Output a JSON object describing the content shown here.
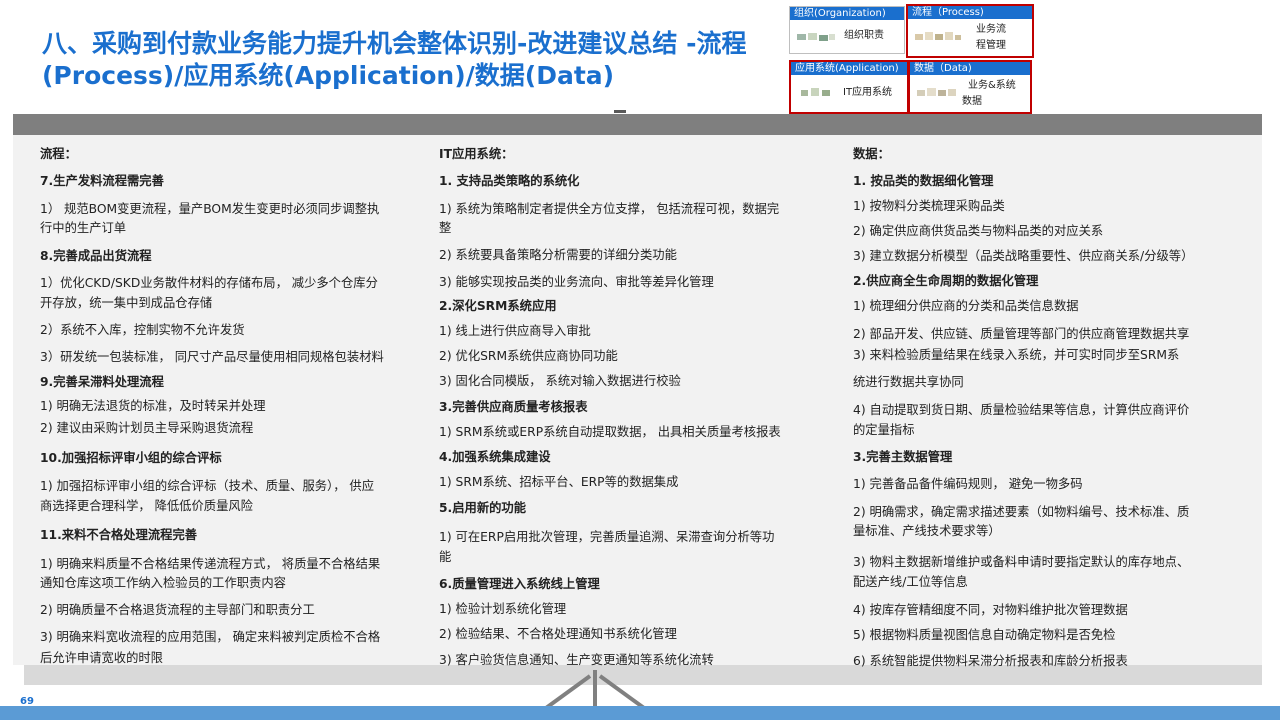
{
  "title": {
    "line1": "八、采购到付款业务能力提升机会整体识别-改进建议总结 -流程",
    "line2": "(Process)/应用系统(Application)/数据(Data)"
  },
  "legend": {
    "org": {
      "header": "组织(Organization)",
      "label": "组织职责"
    },
    "process": {
      "header": "流程（Process)",
      "label1": "业务流",
      "label2": "程管理"
    },
    "app": {
      "header": "应用系统(Application)",
      "label": "IT应用系统"
    },
    "data": {
      "header": "数据（Data)",
      "label1": "业务&系统",
      "label2": "数据"
    }
  },
  "columns": {
    "process": {
      "heading": "流程：",
      "lines": [
        {
          "text": "7.生产发料流程需完善",
          "type": "sec"
        },
        {
          "text": "1）  规范BOM变更流程，量产BOM发生变更时必须同步调整执",
          "type": "item"
        },
        {
          "text": "      行中的生产订单",
          "type": "item"
        },
        {
          "text": "8.完善成品出货流程",
          "type": "sec"
        },
        {
          "text": "1）优化CKD/SKD业务散件材料的存储布局，  减少多个仓库分",
          "type": "item"
        },
        {
          "text": "开存放，统一集中到成品仓存储",
          "type": "item"
        },
        {
          "text": "2）系统不入库，控制实物不允许发货",
          "type": "item"
        },
        {
          "text": "3）研发统一包装标准，  同尺寸产品尽量使用相同规格包装材料",
          "type": "item"
        },
        {
          "text": "9.完善呆滞料处理流程",
          "type": "sec"
        },
        {
          "text": "1)    明确无法退货的标准，及时转呆并处理",
          "type": "item"
        },
        {
          "text": "2)    建议由采购计划员主导采购退货流程",
          "type": "item"
        },
        {
          "text": "10.加强招标评审小组的综合评标",
          "type": "sec"
        },
        {
          "text": "1)    加强招标评审小组的综合评标（技术、质量、服务），  供应",
          "type": "item"
        },
        {
          "text": "      商选择更合理科学，  降低低价质量风险",
          "type": "item"
        },
        {
          "text": "11.来料不合格处理流程完善",
          "type": "sec"
        },
        {
          "text": "1)    明确来料质量不合格结果传递流程方式，  将质量不合格结果",
          "type": "item"
        },
        {
          "text": "      通知仓库这项工作纳入检验员的工作职责内容",
          "type": "item"
        },
        {
          "text": "2)    明确质量不合格退货流程的主导部门和职责分工",
          "type": "item"
        },
        {
          "text": "3)    明确来料宽收流程的应用范围，  确定来料被判定质检不合格",
          "type": "item"
        },
        {
          "text": "      后允许申请宽收的时限",
          "type": "item"
        }
      ]
    },
    "it": {
      "heading": "IT应用系统：",
      "lines": [
        {
          "text": "1. 支持品类策略的系统化",
          "type": "sec"
        },
        {
          "text": "1)    系统为策略制定者提供全方位支撑，  包括流程可视，数据完",
          "type": "item"
        },
        {
          "text": "      整",
          "type": "item"
        },
        {
          "text": "2)    系统要具备策略分析需要的详细分类功能",
          "type": "item"
        },
        {
          "text": "3)    能够实现按品类的业务流向、审批等差异化管理",
          "type": "item"
        },
        {
          "text": "2.深化SRM系统应用",
          "type": "sec"
        },
        {
          "text": "1)    线上进行供应商导入审批",
          "type": "item"
        },
        {
          "text": "2)    优化SRM系统供应商协同功能",
          "type": "item"
        },
        {
          "text": "3)    固化合同模版，  系统对输入数据进行校验",
          "type": "item"
        },
        {
          "text": "3.完善供应商质量考核报表",
          "type": "sec"
        },
        {
          "text": "1)    SRM系统或ERP系统自动提取数据，  出具相关质量考核报表",
          "type": "item"
        },
        {
          "text": "4.加强系统集成建设",
          "type": "sec"
        },
        {
          "text": "1)    SRM系统、招标平台、ERP等的数据集成",
          "type": "item"
        },
        {
          "text": "5.启用新的功能",
          "type": "sec"
        },
        {
          "text": "1)    可在ERP启用批次管理，完善质量追溯、呆滞查询分析等功",
          "type": "item"
        },
        {
          "text": "      能",
          "type": "item"
        },
        {
          "text": "6.质量管理进入系统线上管理",
          "type": "sec"
        },
        {
          "text": "1)    检验计划系统化管理",
          "type": "item"
        },
        {
          "text": "2)    检验结果、不合格处理通知书系统化管理",
          "type": "item"
        },
        {
          "text": "3)    客户验货信息通知、生产变更通知等系统化流转",
          "type": "item"
        }
      ]
    },
    "data": {
      "heading": "数据：",
      "lines": [
        {
          "text": "1. 按品类的数据细化管理",
          "type": "sec"
        },
        {
          "text": "1)    按物料分类梳理采购品类",
          "type": "item"
        },
        {
          "text": "2)    确定供应商供货品类与物料品类的对应关系",
          "type": "item"
        },
        {
          "text": "3)    建立数据分析模型（品类战略重要性、供应商关系/分级等）",
          "type": "item"
        },
        {
          "text": "2.供应商全生命周期的数据化管理",
          "type": "sec"
        },
        {
          "text": "1)    梳理细分供应商的分类和品类信息数据",
          "type": "item"
        },
        {
          "text": "2)    部品开发、供应链、质量管理等部门的供应商管理数据共享",
          "type": "item"
        },
        {
          "text": "3)    来料检验质量结果在线录入系统，并可实时同步至SRM系",
          "type": "item"
        },
        {
          "text": "      统进行数据共享协同",
          "type": "item"
        },
        {
          "text": "4)    自动提取到货日期、质量检验结果等信息，计算供应商评价",
          "type": "item"
        },
        {
          "text": "      的定量指标",
          "type": "item"
        },
        {
          "text": "3.完善主数据管理",
          "type": "sec"
        },
        {
          "text": "1)    完善备品备件编码规则，  避免一物多码",
          "type": "item"
        },
        {
          "text": "2)    明确需求，确定需求描述要素（如物料编号、技术标准、质",
          "type": "item"
        },
        {
          "text": "      量标准、产线技术要求等）",
          "type": "item"
        },
        {
          "text": "3)    物料主数据新增维护或备料申请时要指定默认的库存地点、",
          "type": "item"
        },
        {
          "text": "      配送产线/工位等信息",
          "type": "item"
        },
        {
          "text": "4)    按库存管精细度不同，对物料维护批次管理数据",
          "type": "item"
        },
        {
          "text": "5)    根据物料质量视图信息自动确定物料是否免检",
          "type": "item"
        },
        {
          "text": "6)    系统智能提供物料呆滞分析报表和库龄分析报表",
          "type": "item"
        }
      ]
    }
  },
  "page_number": "69"
}
